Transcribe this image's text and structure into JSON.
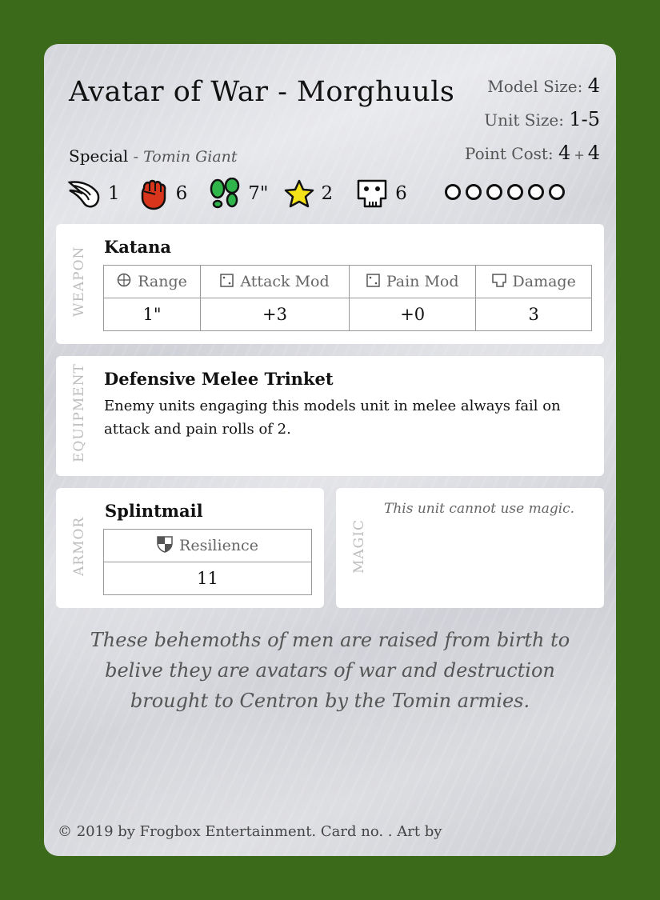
{
  "title": "Avatar of War - Morghuuls",
  "stats": {
    "model_size_label": "Model Size:",
    "model_size": "4",
    "unit_size_label": "Unit Size:",
    "unit_size": "1-5",
    "point_cost_label": "Point Cost:",
    "point_cost_a": "4",
    "point_cost_plus": "+",
    "point_cost_b": "4"
  },
  "special": {
    "label": "Special",
    "value": "- Tomin Giant"
  },
  "attributes": [
    {
      "icon": "wing-icon",
      "value": "1"
    },
    {
      "icon": "fist-icon",
      "value": "6"
    },
    {
      "icon": "footprints-icon",
      "value": "7\""
    },
    {
      "icon": "star-icon",
      "value": "2"
    },
    {
      "icon": "skull-icon",
      "value": "6"
    }
  ],
  "wound_pips": 6,
  "weapon": {
    "section_label": "WEAPON",
    "name": "Katana",
    "headers": [
      "Range",
      "Attack Mod",
      "Pain Mod",
      "Damage"
    ],
    "values": [
      "1\"",
      "+3",
      "+0",
      "3"
    ]
  },
  "equipment": {
    "section_label": "EQUIPMENT",
    "name": "Defensive Melee Trinket",
    "text": "Enemy units engaging this models unit in melee always fail on attack and pain rolls of 2."
  },
  "armor": {
    "section_label": "ARMOR",
    "name": "Splintmail",
    "header": "Resilience",
    "value": "11"
  },
  "magic": {
    "section_label": "MAGIC",
    "text": "This unit cannot use magic."
  },
  "flavor": "These behemoths of men are raised from birth to belive they are avatars of war and destruction brought to Centron by the Tomin armies.",
  "footer": "© 2019 by Frogbox Entertainment. Card no. . Art by",
  "colors": {
    "background": "#3a6a1a",
    "fist": "#d9341c",
    "footprints": "#2fb54a",
    "star": "#f5e31a"
  }
}
